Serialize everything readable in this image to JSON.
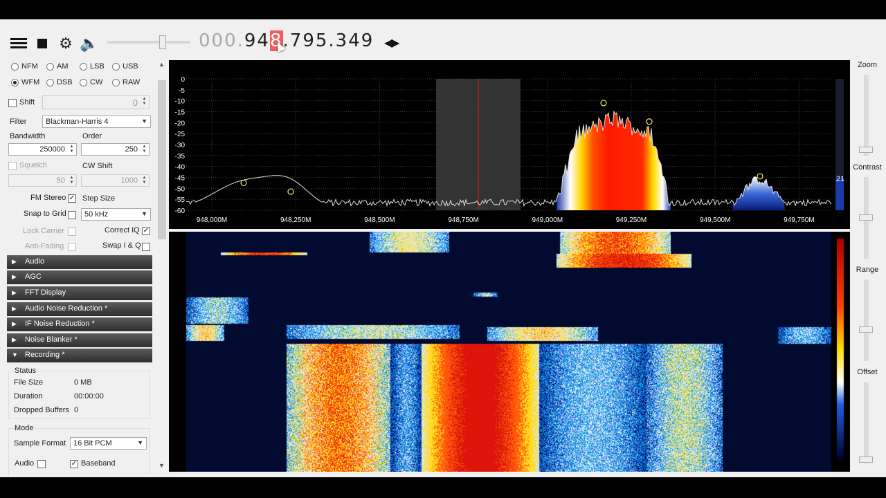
{
  "toolbar": {
    "freq_prefix": "000.",
    "freq_pre": "94",
    "freq_hl": "8",
    "freq_post": ".795.349",
    "volume": 0.68
  },
  "modes": [
    {
      "label": "NFM",
      "selected": false
    },
    {
      "label": "AM",
      "selected": false
    },
    {
      "label": "LSB",
      "selected": false
    },
    {
      "label": "USB",
      "selected": false
    },
    {
      "label": "WFM",
      "selected": true
    },
    {
      "label": "DSB",
      "selected": false
    },
    {
      "label": "CW",
      "selected": false
    },
    {
      "label": "RAW",
      "selected": false
    }
  ],
  "radio": {
    "shift_label": "Shift",
    "shift_value": "0",
    "filter_label": "Filter",
    "filter_value": "Blackman-Harris 4",
    "bandwidth_label": "Bandwidth",
    "bandwidth_value": "250000",
    "order_label": "Order",
    "order_value": "250",
    "squelch_label": "Squelch",
    "squelch_value": "50",
    "cw_shift_label": "CW Shift",
    "cw_shift_value": "1000",
    "fm_stereo_label": "FM Stereo",
    "step_size_label": "Step Size",
    "snap_label": "Snap to Grid",
    "step_value": "50 kHz",
    "lock_carrier_label": "Lock Carrier",
    "correct_iq_label": "Correct IQ",
    "anti_fading_label": "Anti-Fading",
    "swap_iq_label": "Swap I & Q"
  },
  "sections": [
    "Audio",
    "AGC",
    "FFT Display",
    "Audio Noise Reduction *",
    "IF Noise Reduction *",
    "Noise Blanker *",
    "Recording *"
  ],
  "recording": {
    "status_title": "Status",
    "file_size_label": "File Size",
    "file_size_value": "0 MB",
    "duration_label": "Duration",
    "duration_value": "00:00:00",
    "dropped_label": "Dropped Buffers",
    "dropped_value": "0",
    "mode_title": "Mode",
    "sample_format_label": "Sample Format",
    "sample_format_value": "16 Bit PCM",
    "audio_label": "Audio",
    "baseband_label": "Baseband"
  },
  "spectrum": {
    "y_ticks": [
      "0",
      "-5",
      "-10",
      "-15",
      "-20",
      "-25",
      "-30",
      "-35",
      "-40",
      "-45",
      "-50",
      "-55",
      "-60"
    ],
    "x_ticks": [
      "948,000M",
      "948,250M",
      "948,500M",
      "948,750M",
      "949,000M",
      "949,250M",
      "949,500M",
      "949,750M"
    ],
    "level_value": "21"
  },
  "right": {
    "zoom_label": "Zoom",
    "contrast_label": "Contrast",
    "range_label": "Range",
    "offset_label": "Offset"
  }
}
